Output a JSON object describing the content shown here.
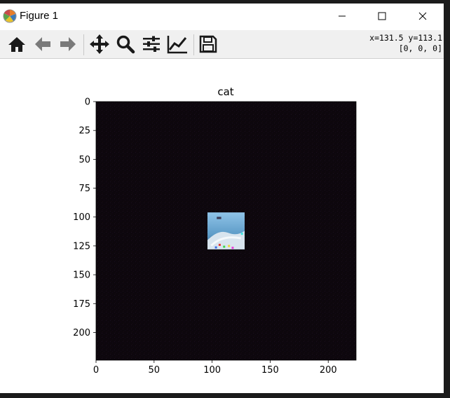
{
  "window": {
    "title": "Figure 1"
  },
  "toolbar": {
    "tools": [
      {
        "name": "home-icon"
      },
      {
        "name": "back-icon"
      },
      {
        "name": "forward-icon"
      },
      {
        "name": "pan-icon"
      },
      {
        "name": "zoom-icon"
      },
      {
        "name": "subplots-icon"
      },
      {
        "name": "customize-icon"
      },
      {
        "name": "save-icon"
      }
    ],
    "coords_line1": "x=131.5 y=113.1",
    "coords_line2": "[0, 0, 0]"
  },
  "plot": {
    "title": "cat",
    "colors": {
      "background": "#0d070d",
      "axis": "#000000"
    },
    "chart_data": {
      "type": "image",
      "title": "cat",
      "xlim": [
        0,
        224
      ],
      "ylim": [
        224,
        0
      ],
      "xticks": [
        0,
        50,
        100,
        150,
        200
      ],
      "yticks": [
        0,
        25,
        50,
        75,
        100,
        125,
        150,
        175,
        200
      ],
      "xtick_labels": [
        "0",
        "50",
        "100",
        "150",
        "200"
      ],
      "ytick_labels": [
        "0",
        "25",
        "50",
        "75",
        "100",
        "125",
        "150",
        "175",
        "200"
      ],
      "inset_region": {
        "x0": 96,
        "x1": 128,
        "y0": 96,
        "y1": 128
      }
    }
  }
}
